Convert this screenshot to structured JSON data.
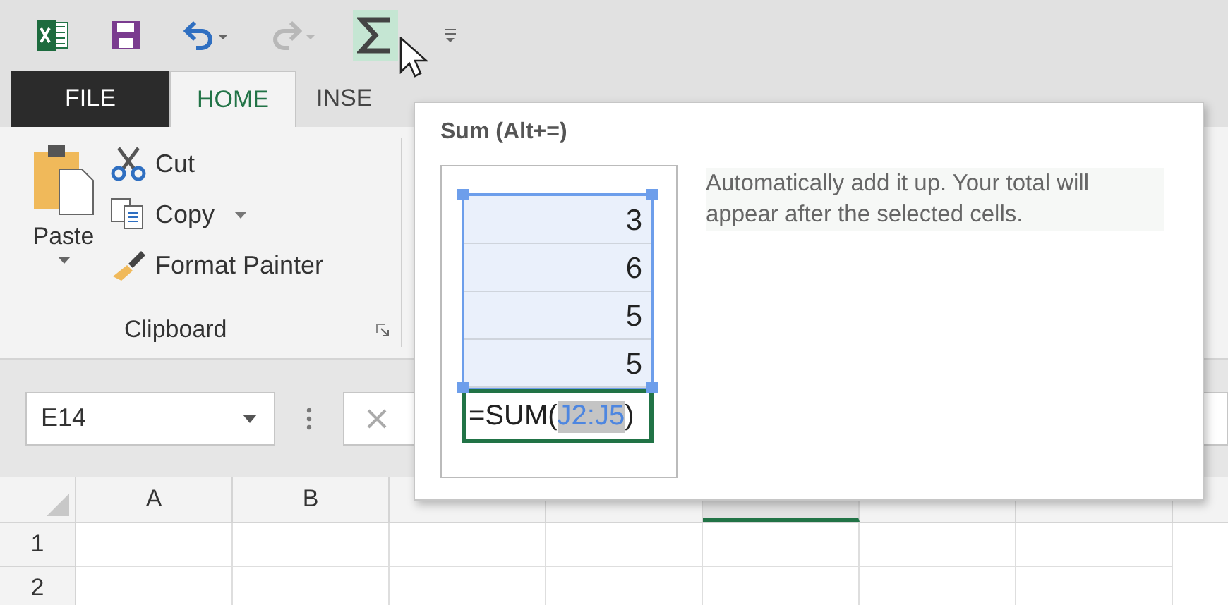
{
  "quick_access": [
    {
      "kind": "app",
      "disabled": false,
      "hovered": false
    },
    {
      "kind": "save",
      "disabled": false,
      "hovered": false
    },
    {
      "kind": "undo",
      "disabled": false,
      "hovered": false
    },
    {
      "kind": "redo",
      "disabled": true,
      "hovered": false
    },
    {
      "kind": "sum",
      "disabled": false,
      "hovered": true
    },
    {
      "kind": "customize",
      "disabled": false,
      "hovered": false
    }
  ],
  "tabs": [
    {
      "label": "FILE",
      "kind": "file",
      "selected": false
    },
    {
      "label": "HOME",
      "kind": "tab",
      "selected": true
    },
    {
      "label": "INSE",
      "kind": "tab",
      "selected": false
    }
  ],
  "clipboard": {
    "paste": "Paste",
    "cut": "Cut",
    "copy": "Copy",
    "format_painter": "Format Painter",
    "group_label": "Clipboard"
  },
  "name_box": {
    "value": "E14"
  },
  "columns": [
    {
      "label": "A",
      "selected": false
    },
    {
      "label": "B",
      "selected": false
    },
    {
      "selected": false
    },
    {
      "selected": false
    },
    {
      "selected": true
    },
    {
      "selected": false
    },
    {
      "selected": false
    }
  ],
  "rows": [
    "1",
    "2"
  ],
  "tooltip": {
    "title": "Sum (Alt+=)",
    "description": "Automatically add it up. Your total will appear after the selected cells.",
    "example_values": [
      "3",
      "6",
      "5",
      "5"
    ],
    "formula_prefix": "=SUM(",
    "formula_range": "J2:J5",
    "formula_suffix": ")"
  }
}
